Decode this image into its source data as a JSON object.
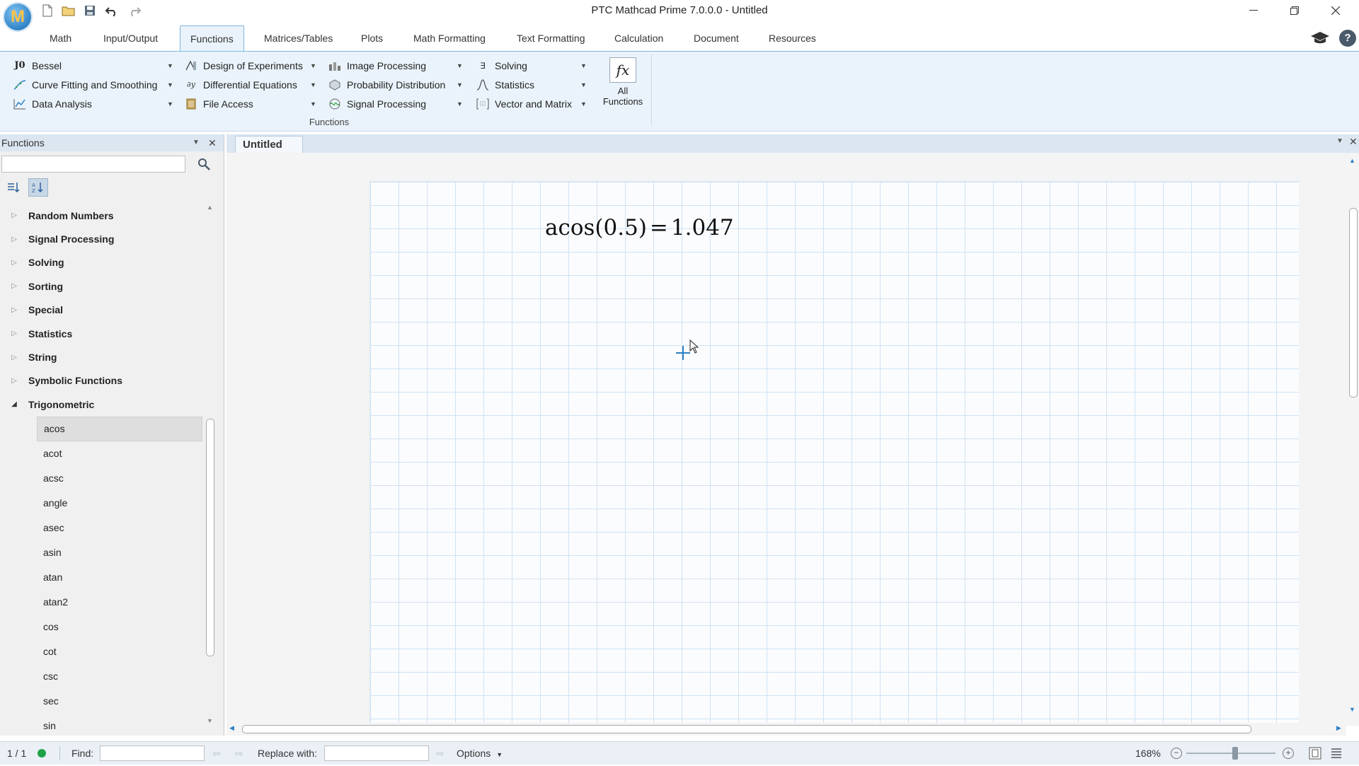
{
  "window": {
    "title": "PTC Mathcad Prime 7.0.0.0 - Untitled",
    "logo_letter": "M"
  },
  "ribbon_tabs": [
    {
      "label": "Math"
    },
    {
      "label": "Input/Output"
    },
    {
      "label": "Functions"
    },
    {
      "label": "Matrices/Tables"
    },
    {
      "label": "Plots"
    },
    {
      "label": "Math Formatting"
    },
    {
      "label": "Text Formatting"
    },
    {
      "label": "Calculation"
    },
    {
      "label": "Document"
    },
    {
      "label": "Resources"
    }
  ],
  "active_tab": "Functions",
  "ribbon": {
    "col1": [
      {
        "label": "Bessel",
        "icon": "J0"
      },
      {
        "label": "Curve Fitting and Smoothing",
        "icon": "curve-icon"
      },
      {
        "label": "Data Analysis",
        "icon": "chart-icon"
      }
    ],
    "col2": [
      {
        "label": "Design of Experiments",
        "icon": "doe-icon"
      },
      {
        "label": "Differential Equations",
        "icon": "diffeq-icon"
      },
      {
        "label": "File Access",
        "icon": "file-icon"
      }
    ],
    "col3": [
      {
        "label": "Image Processing",
        "icon": "image-icon"
      },
      {
        "label": "Probability Distribution",
        "icon": "probability-icon"
      },
      {
        "label": "Signal Processing",
        "icon": "signal-icon"
      }
    ],
    "col4": [
      {
        "label": "Solving",
        "icon": "solving-icon"
      },
      {
        "label": "Statistics",
        "icon": "statistics-icon"
      },
      {
        "label": "Vector and Matrix",
        "icon": "matrix-icon"
      }
    ],
    "all_functions": {
      "icon": "fx",
      "line1": "All",
      "line2": "Functions"
    },
    "group_label": "Functions"
  },
  "functions_panel": {
    "title": "Functions",
    "search_value": "",
    "categories": [
      "Random Numbers",
      "Signal Processing",
      "Solving",
      "Sorting",
      "Special",
      "Statistics",
      "String",
      "Symbolic Functions",
      "Trigonometric"
    ],
    "expanded_category": "Trigonometric",
    "trig_functions": [
      "acos",
      "acot",
      "acsc",
      "angle",
      "asec",
      "asin",
      "atan",
      "atan2",
      "cos",
      "cot",
      "csc",
      "sec",
      "sin"
    ],
    "selected_function": "acos"
  },
  "document": {
    "tab_label": "Untitled",
    "expression": {
      "func": "acos",
      "arg": "(0.5)",
      "equals": "=",
      "result": "1.047"
    }
  },
  "status": {
    "page": "1 / 1",
    "find_label": "Find:",
    "find_value": "",
    "replace_label": "Replace with:",
    "replace_value": "",
    "options_label": "Options",
    "zoom": "168%",
    "zoom_fraction": 0.55
  },
  "colors": {
    "accent": "#2b7fc5",
    "ribbon_bg": "#eaf3fb",
    "grid": "#cfe3f3",
    "status_ok": "#1fa34a"
  }
}
